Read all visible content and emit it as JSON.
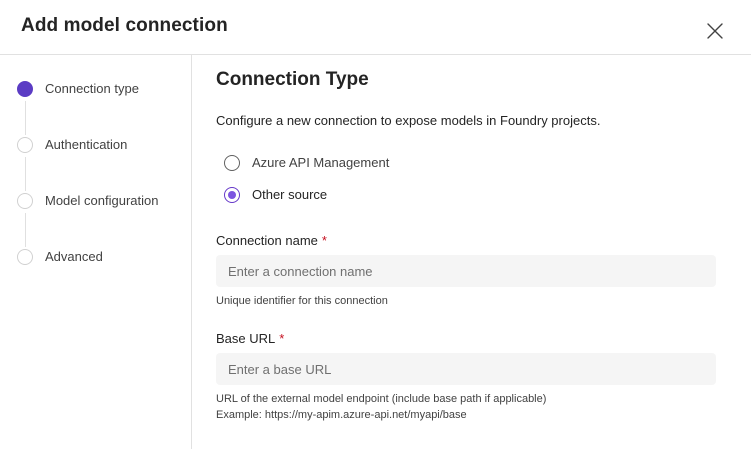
{
  "dialog": {
    "title": "Add model connection",
    "close_icon": "close-icon"
  },
  "steps": [
    {
      "label": "Connection type",
      "active": true
    },
    {
      "label": "Authentication",
      "active": false
    },
    {
      "label": "Model configuration",
      "active": false
    },
    {
      "label": "Advanced",
      "active": false
    }
  ],
  "content": {
    "title": "Connection Type",
    "description": "Configure a new connection to expose models in Foundry projects.",
    "options": [
      {
        "label": "Azure API Management",
        "checked": false
      },
      {
        "label": "Other source",
        "checked": true
      }
    ],
    "connection_name": {
      "label": "Connection name",
      "required_marker": "*",
      "placeholder": "Enter a connection name",
      "value": "",
      "hint": "Unique identifier for this connection"
    },
    "base_url": {
      "label": "Base URL",
      "required_marker": "*",
      "placeholder": "Enter a base URL",
      "value": "",
      "hint_line1": "URL of the external model endpoint (include base path if applicable)",
      "hint_line2": "Example: https://my-apim.azure-api.net/myapi/base"
    }
  },
  "colors": {
    "accent": "#5b3cc4",
    "required": "#c50f1f",
    "divider": "#e1e1e1",
    "input_bg": "#f5f5f5"
  }
}
